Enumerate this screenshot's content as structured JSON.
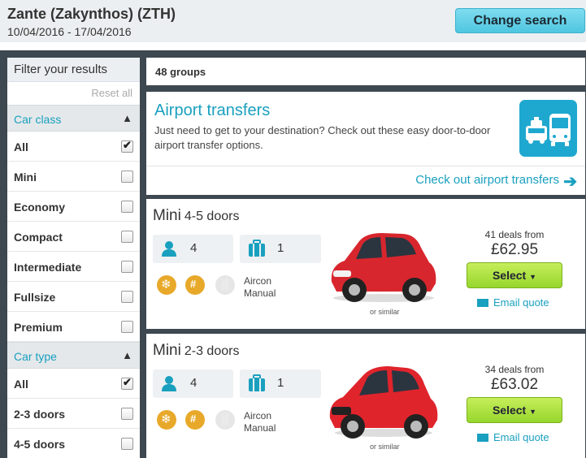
{
  "header": {
    "title": "Zante (Zakynthos) (ZTH)",
    "dates": "10/04/2016 - 17/04/2016",
    "change_search": "Change search"
  },
  "sidebar": {
    "filter_title": "Filter your results",
    "reset_all": "Reset all",
    "car_class": {
      "title": "Car class",
      "options": [
        {
          "label": "All",
          "checked": true
        },
        {
          "label": "Mini",
          "checked": false
        },
        {
          "label": "Economy",
          "checked": false
        },
        {
          "label": "Compact",
          "checked": false
        },
        {
          "label": "Intermediate",
          "checked": false
        },
        {
          "label": "Fullsize",
          "checked": false
        },
        {
          "label": "Premium",
          "checked": false
        }
      ]
    },
    "car_type": {
      "title": "Car type",
      "options": [
        {
          "label": "All",
          "checked": true
        },
        {
          "label": "2-3 doors",
          "checked": false
        },
        {
          "label": "4-5 doors",
          "checked": false
        }
      ]
    }
  },
  "results": {
    "groups_count": "48 groups",
    "transfer": {
      "title": "Airport transfers",
      "description": "Just need to get to your destination? Check out these easy door-to-door airport transfer options.",
      "link": "Check out airport transfers"
    },
    "cars": [
      {
        "class": "Mini",
        "doors": "4-5 doors",
        "passengers": "4",
        "bags": "1",
        "features": [
          "Aircon",
          "Manual"
        ],
        "similar": "or similar",
        "deals": "41 deals from",
        "price": "£62.95",
        "select": "Select",
        "email": "Email quote"
      },
      {
        "class": "Mini",
        "doors": "2-3 doors",
        "passengers": "4",
        "bags": "1",
        "features": [
          "Aircon",
          "Manual"
        ],
        "similar": "or similar",
        "deals": "34 deals from",
        "price": "£63.02",
        "select": "Select",
        "email": "Email quote"
      }
    ]
  },
  "colors": {
    "accent": "#1aa0bf",
    "select_green": "#96d62d",
    "feature_gold": "#e8a92a",
    "frame_dark": "#3d4850"
  }
}
